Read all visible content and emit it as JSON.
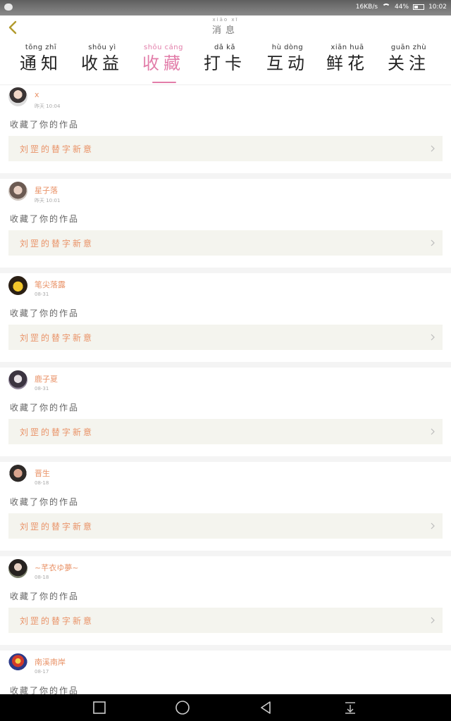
{
  "status_bar": {
    "net_speed": "16KB/s",
    "battery_percent": "44%",
    "battery_level": 0.44,
    "time": "10:02"
  },
  "header": {
    "title": "消息",
    "title_pinyin": "xiāo xī"
  },
  "tabs": [
    {
      "label": "通知",
      "pinyin": "tōng zhī"
    },
    {
      "label": "收益",
      "pinyin": "shōu yì"
    },
    {
      "label": "收藏",
      "pinyin": "shōu cáng"
    },
    {
      "label": "打卡",
      "pinyin": "dǎ kǎ"
    },
    {
      "label": "互动",
      "pinyin": "hù dòng"
    },
    {
      "label": "鲜花",
      "pinyin": "xiān huā"
    },
    {
      "label": "关注",
      "pinyin": "guān zhù"
    }
  ],
  "active_tab": "收藏",
  "notifications": [
    {
      "user": "x",
      "time": "昨天 10:04",
      "action": "收藏了你的作品",
      "work": "刘罡的替字新意"
    },
    {
      "user": "星子落",
      "time": "昨天 10:01",
      "action": "收藏了你的作品",
      "work": "刘罡的替字新意"
    },
    {
      "user": "笔尖落露",
      "time": "08-31",
      "action": "收藏了你的作品",
      "work": "刘罡的替字新意"
    },
    {
      "user": "鹿子夏",
      "time": "08-31",
      "action": "收藏了你的作品",
      "work": "刘罡的替字新意"
    },
    {
      "user": "晋生",
      "time": "08-18",
      "action": "收藏了你的作品",
      "work": "刘罡的替字新意"
    },
    {
      "user": "~芊衣ゆ夢~",
      "time": "08-18",
      "action": "收藏了你的作品",
      "work": "刘罡的替字新意"
    },
    {
      "user": "南溪南岸",
      "time": "08-17",
      "action": "收藏了你的作品",
      "work": ""
    }
  ],
  "colors": {
    "accent": "#e27da9",
    "name_color": "#e99267",
    "work_bg": "#f4f4ee"
  },
  "icons": [
    "back-icon",
    "chevron-right-icon",
    "square-icon",
    "home-circle-icon",
    "back-triangle-icon",
    "notification-pull-icon"
  ]
}
